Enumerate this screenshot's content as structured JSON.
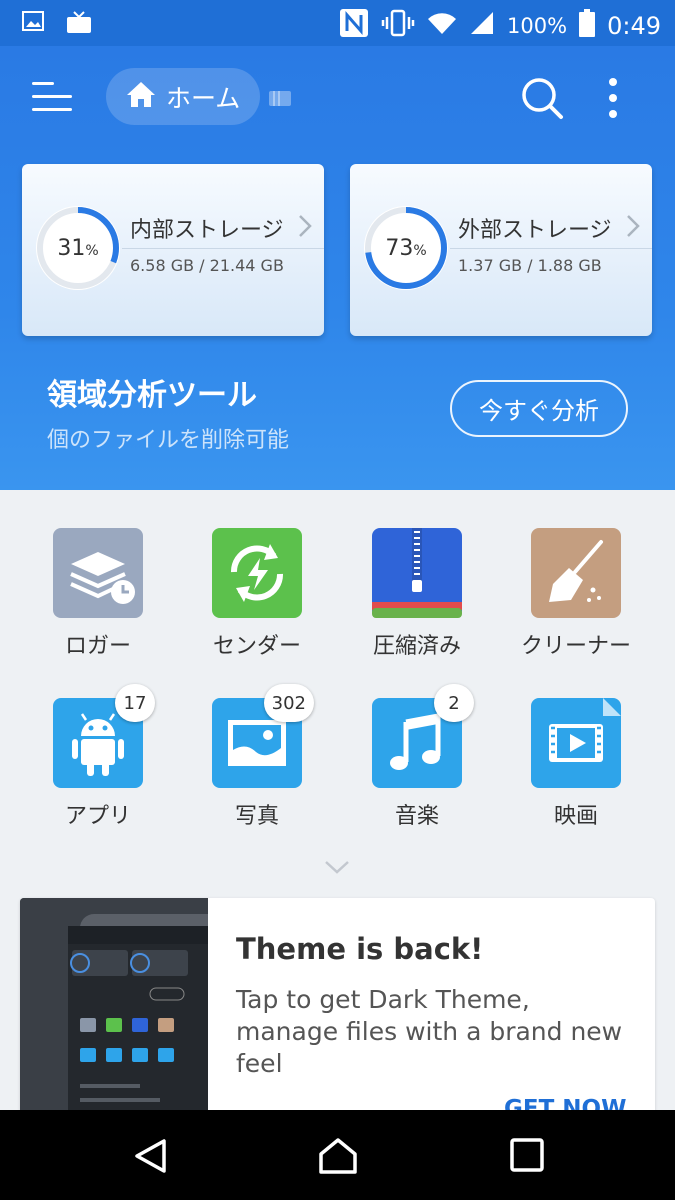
{
  "status_bar": {
    "battery": "100%",
    "time": "0:49"
  },
  "header": {
    "location": "ホーム"
  },
  "storage": [
    {
      "name": "内部ストレージ",
      "percent": 31,
      "percent_unit": "%",
      "size": "6.58 GB / 21.44 GB"
    },
    {
      "name": "外部ストレージ",
      "percent": 73,
      "percent_unit": "%",
      "size": "1.37 GB / 1.88 GB"
    }
  ],
  "analyzer": {
    "title": "領域分析ツール",
    "subtitle": "個のファイルを削除可能",
    "button": "今すぐ分析"
  },
  "grid": [
    {
      "label": "ロガー",
      "icon": "logger-icon"
    },
    {
      "label": "センダー",
      "icon": "sender-icon"
    },
    {
      "label": "圧縮済み",
      "icon": "compressed-icon"
    },
    {
      "label": "クリーナー",
      "icon": "cleaner-icon"
    },
    {
      "label": "アプリ",
      "icon": "android-icon",
      "badge": "17"
    },
    {
      "label": "写真",
      "icon": "photo-icon",
      "badge": "302"
    },
    {
      "label": "音楽",
      "icon": "music-icon",
      "badge": "2"
    },
    {
      "label": "映画",
      "icon": "movie-icon"
    }
  ],
  "promo": {
    "title": "Theme is back!",
    "body": "Tap to get Dark Theme, manage files with a brand new feel",
    "cta": "GET NOW"
  },
  "colors": {
    "primary": "#1f6fd6",
    "ring": "#2a7ae4"
  }
}
